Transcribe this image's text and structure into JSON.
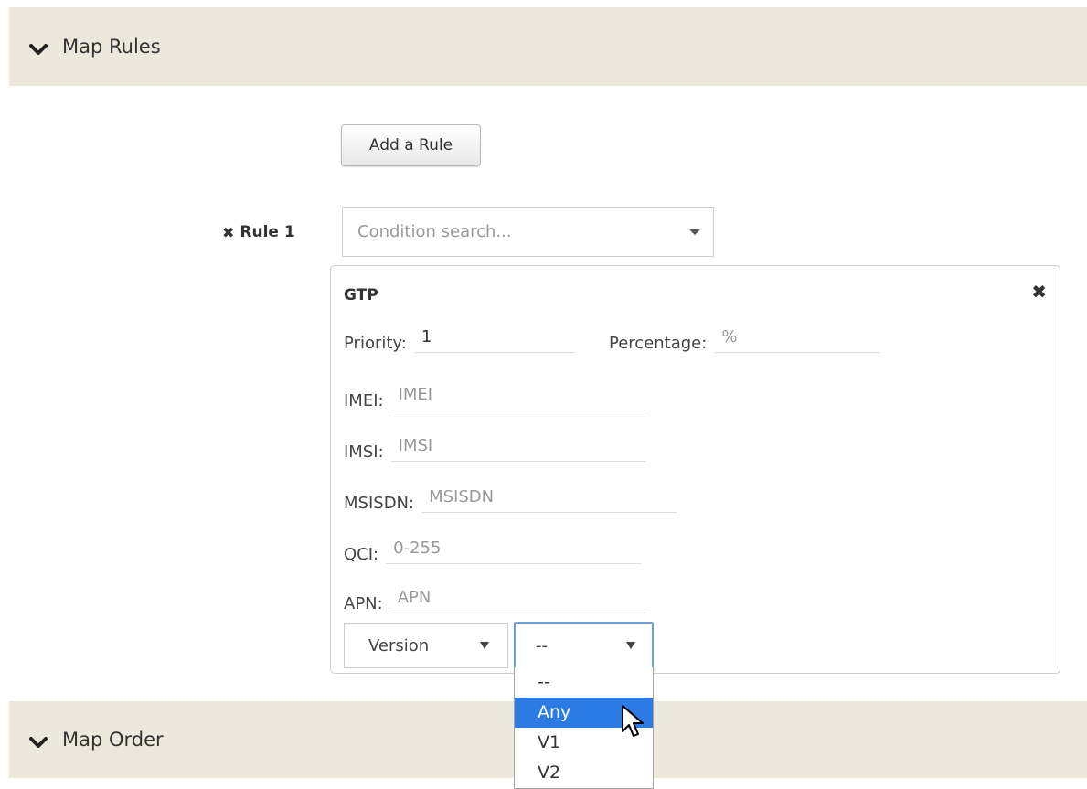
{
  "sections": {
    "map_rules": {
      "title": "Map Rules",
      "icon": "chevron-down-icon"
    },
    "map_order": {
      "title": "Map Order",
      "icon": "chevron-down-icon"
    }
  },
  "add_rule_button": "Add a Rule",
  "rule": {
    "label": "Rule 1",
    "remove_icon": "close-icon",
    "condition_search": {
      "placeholder": "Condition search..."
    }
  },
  "panel": {
    "title": "GTP",
    "fields": {
      "priority": {
        "label": "Priority:",
        "value": "1"
      },
      "percentage": {
        "label": "Percentage:",
        "placeholder": "%"
      },
      "imei": {
        "label": "IMEI:",
        "placeholder": "IMEI"
      },
      "imsi": {
        "label": "IMSI:",
        "placeholder": "IMSI"
      },
      "msisdn": {
        "label": "MSISDN:",
        "placeholder": "MSISDN"
      },
      "qci": {
        "label": "QCI:",
        "placeholder": "0-255"
      },
      "apn": {
        "label": "APN:",
        "placeholder": "APN"
      }
    },
    "version_select": {
      "value": "Version"
    },
    "version_value_select": {
      "value": "--",
      "options": [
        "--",
        "Any",
        "V1",
        "V2"
      ],
      "highlighted": "Any"
    }
  },
  "colors": {
    "header_bg": "#ece8dc",
    "highlight": "#2c7be5",
    "focus_border": "#6aa3d8"
  }
}
